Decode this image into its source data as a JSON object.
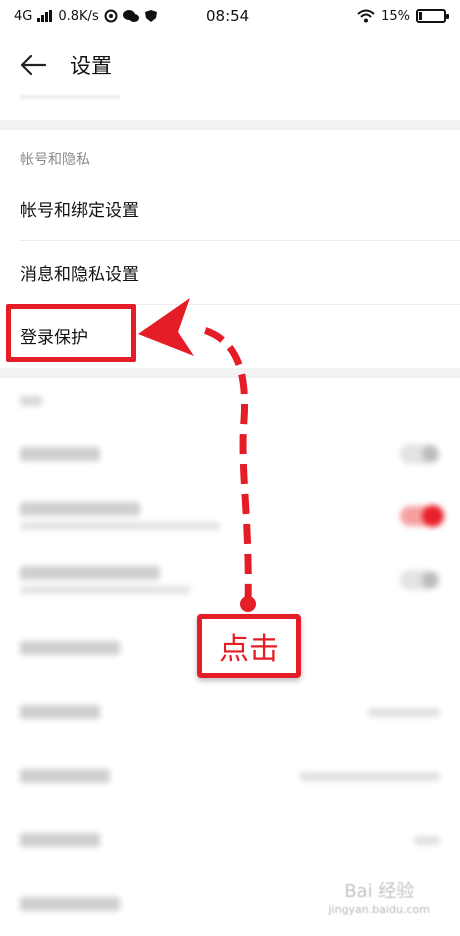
{
  "status_bar": {
    "network": "4G",
    "speed": "0.8K/s",
    "time": "08:54",
    "battery": "15%"
  },
  "header": {
    "title": "设置"
  },
  "sections": [
    {
      "label": "帐号和隐私",
      "items": [
        {
          "label": "帐号和绑定设置"
        },
        {
          "label": "消息和隐私设置"
        },
        {
          "label": "登录保护"
        }
      ]
    }
  ],
  "blurred_rows": [
    {
      "toggle": "off"
    },
    {
      "toggle": "on"
    },
    {
      "toggle": "off"
    },
    {
      "toggle": "none"
    },
    {
      "toggle": "none"
    },
    {
      "toggle": "none"
    },
    {
      "toggle": "none"
    },
    {
      "toggle": "none"
    }
  ],
  "annotation": {
    "callout_text": "点击",
    "color": "#e41d26"
  },
  "watermark": {
    "line1": "Bai 经验",
    "line2": "jingyan.baidu.com"
  }
}
